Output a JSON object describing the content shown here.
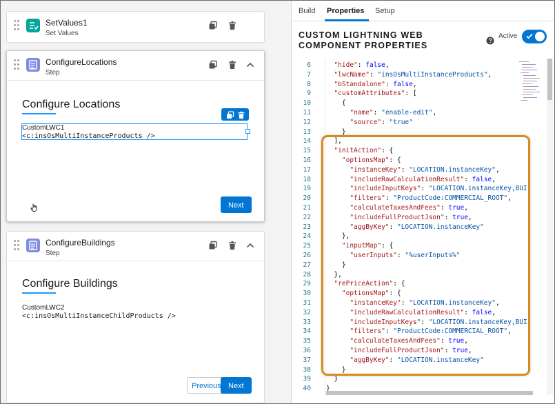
{
  "canvas": {
    "elements": [
      {
        "title": "SetValues1",
        "subtitle": "Set Values"
      },
      {
        "title": "ConfigureLocations",
        "subtitle": "Step"
      },
      {
        "title": "ConfigureBuildings",
        "subtitle": "Step"
      }
    ],
    "steps": {
      "locations": {
        "heading": "Configure Locations",
        "component_name": "CustomLWC1",
        "component_tag": "<c:insOsMultiInstanceProducts />",
        "next_label": "Next"
      },
      "buildings": {
        "heading": "Configure Buildings",
        "component_name": "CustomLWC2",
        "component_tag": "<c:insOsMultiInstanceChildProducts />",
        "previous_label": "Previous",
        "next_label": "Next"
      }
    }
  },
  "panel": {
    "tabs": [
      {
        "label": "Build",
        "active": false
      },
      {
        "label": "Properties",
        "active": true
      },
      {
        "label": "Setup",
        "active": false
      }
    ],
    "title_line1": "CUSTOM LIGHTNING WEB",
    "title_line2": "COMPONENT PROPERTIES",
    "active_label": "Active",
    "active_on": true
  },
  "editor": {
    "lines": [
      {
        "n": "6",
        "t": "  \"hide\": false,"
      },
      {
        "n": "7",
        "t": "  \"lwcName\": \"insOsMultiInstanceProducts\","
      },
      {
        "n": "8",
        "t": "  \"bStandalone\": false,"
      },
      {
        "n": "9",
        "t": "  \"customAttributes\": ["
      },
      {
        "n": "10",
        "t": "    {"
      },
      {
        "n": "11",
        "t": "      \"name\": \"enable-edit\","
      },
      {
        "n": "12",
        "t": "      \"source\": \"true\""
      },
      {
        "n": "13",
        "t": "    }"
      },
      {
        "n": "14",
        "t": "  ],"
      },
      {
        "n": "15",
        "t": "  \"initAction\": {"
      },
      {
        "n": "16",
        "t": "    \"optionsMap\": {"
      },
      {
        "n": "17",
        "t": "      \"instanceKey\": \"LOCATION.instanceKey\","
      },
      {
        "n": "18",
        "t": "      \"includeRawCalculationResult\": false,"
      },
      {
        "n": "19",
        "t": "      \"includeInputKeys\": \"LOCATION.instanceKey,BUI"
      },
      {
        "n": "20",
        "t": "      \"filters\": \"ProductCode:COMMERCIAL_ROOT\","
      },
      {
        "n": "21",
        "t": "      \"calculateTaxesAndFees\": true,"
      },
      {
        "n": "22",
        "t": "      \"includeFullProductJson\": true,"
      },
      {
        "n": "23",
        "t": "      \"aggByKey\": \"LOCATION.instanceKey\""
      },
      {
        "n": "24",
        "t": "    },"
      },
      {
        "n": "25",
        "t": "    \"inputMap\": {"
      },
      {
        "n": "26",
        "t": "      \"userInputs\": \"%userInputs%\""
      },
      {
        "n": "27",
        "t": "    }"
      },
      {
        "n": "28",
        "t": "  },"
      },
      {
        "n": "29",
        "t": "  \"rePriceAction\": {"
      },
      {
        "n": "30",
        "t": "    \"optionsMap\": {"
      },
      {
        "n": "31",
        "t": "      \"instanceKey\": \"LOCATION.instanceKey\","
      },
      {
        "n": "32",
        "t": "      \"includeRawCalculationResult\": false,"
      },
      {
        "n": "33",
        "t": "      \"includeInputKeys\": \"LOCATION.instanceKey,BUI"
      },
      {
        "n": "34",
        "t": "      \"filters\": \"ProductCode:COMMERCIAL_ROOT\","
      },
      {
        "n": "35",
        "t": "      \"calculateTaxesAndFees\": true,"
      },
      {
        "n": "36",
        "t": "      \"includeFullProductJson\": true,"
      },
      {
        "n": "37",
        "t": "      \"aggByKey\": \"LOCATION.instanceKey\""
      },
      {
        "n": "38",
        "t": "    }"
      },
      {
        "n": "39",
        "t": "  }"
      },
      {
        "n": "40",
        "t": "}"
      }
    ]
  },
  "colors": {
    "brand": "#0176d3",
    "highlight": "#d98a1e",
    "teal_icon": "#06a59a",
    "step_icon": "#7f8ce0"
  },
  "icons": {
    "element_actions": [
      "clone-icon",
      "delete-icon",
      "chevron-up-icon"
    ],
    "help": "help-icon"
  }
}
